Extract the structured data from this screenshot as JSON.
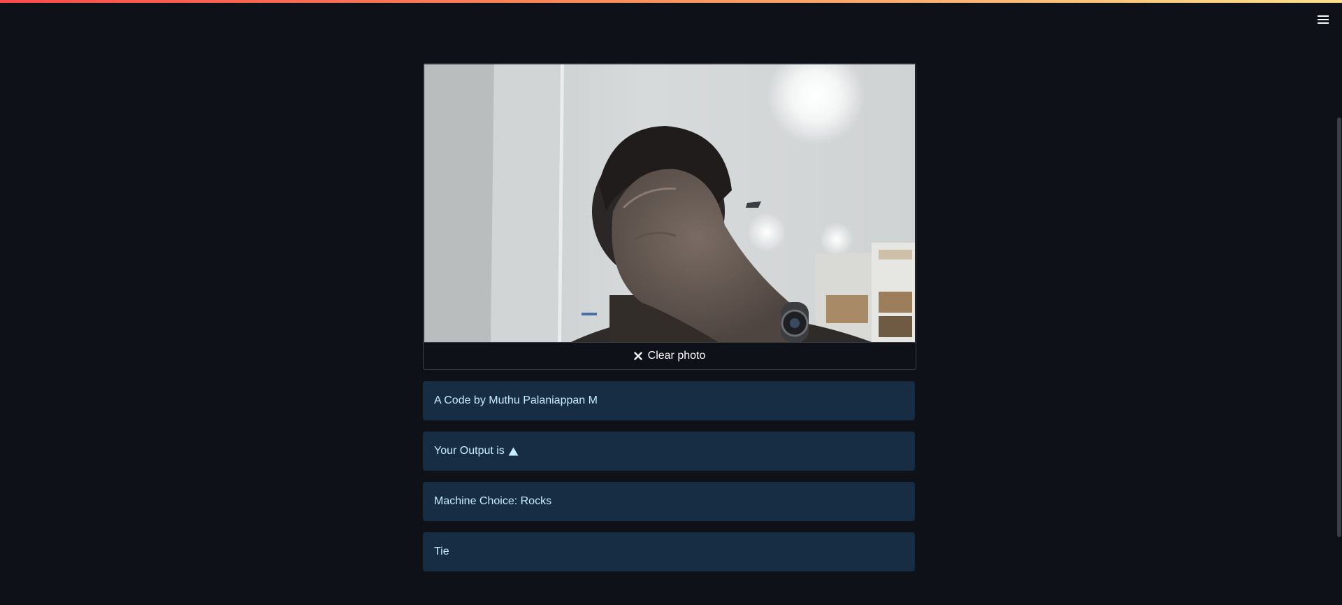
{
  "header": {
    "menu_icon": "hamburger-menu-icon"
  },
  "camera": {
    "clear_label": "Clear photo",
    "clear_icon": "close-icon"
  },
  "messages": [
    {
      "text": "A Code by Muthu Palaniappan M"
    },
    {
      "text": "Your Output is",
      "icon": "triangle-up-icon"
    },
    {
      "text": "Machine Choice: Rocks"
    },
    {
      "text": "Tie"
    }
  ],
  "colors": {
    "background": "#0e1117",
    "info_background": "#172d43",
    "info_text": "#c7ebff",
    "accent_stripe_start": "#ff4b4b",
    "accent_stripe_end": "#ffe08a"
  }
}
